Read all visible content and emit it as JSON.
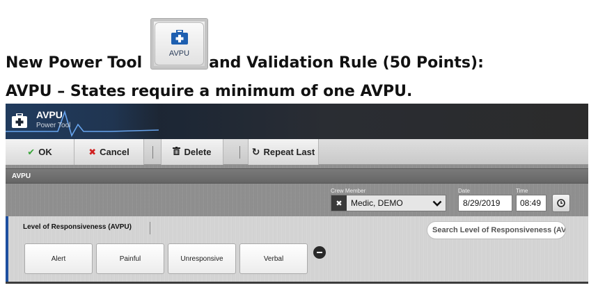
{
  "headline": {
    "line1_before": "New Power Tool",
    "line1_after": "and Validation Rule (50 Points):",
    "line2": "AVPU – States require a minimum of one AVPU.",
    "power_tool_button_label": "AVPU",
    "power_tool_icon": "medical-kit-icon"
  },
  "app": {
    "title": "AVPU",
    "subtitle": "Power Tool",
    "title_icon": "medical-kit-icon",
    "accent_color": "#1d4fa0",
    "toolbar": {
      "ok_label": "OK",
      "cancel_label": "Cancel",
      "delete_label": "Delete",
      "repeat_label": "Repeat Last"
    },
    "section": {
      "title": "AVPU"
    },
    "fields": {
      "crew_label": "Crew Member",
      "crew_value": "Medic, DEMO",
      "date_label": "Date",
      "date_value": "8/29/2019",
      "time_label": "Time",
      "time_value": "08:49"
    },
    "level": {
      "label": "Level of Responsiveness (AVPU)",
      "search_placeholder": "Search Level of Responsiveness (AV",
      "options": [
        "Alert",
        "Painful",
        "Unresponsive",
        "Verbal"
      ]
    }
  }
}
